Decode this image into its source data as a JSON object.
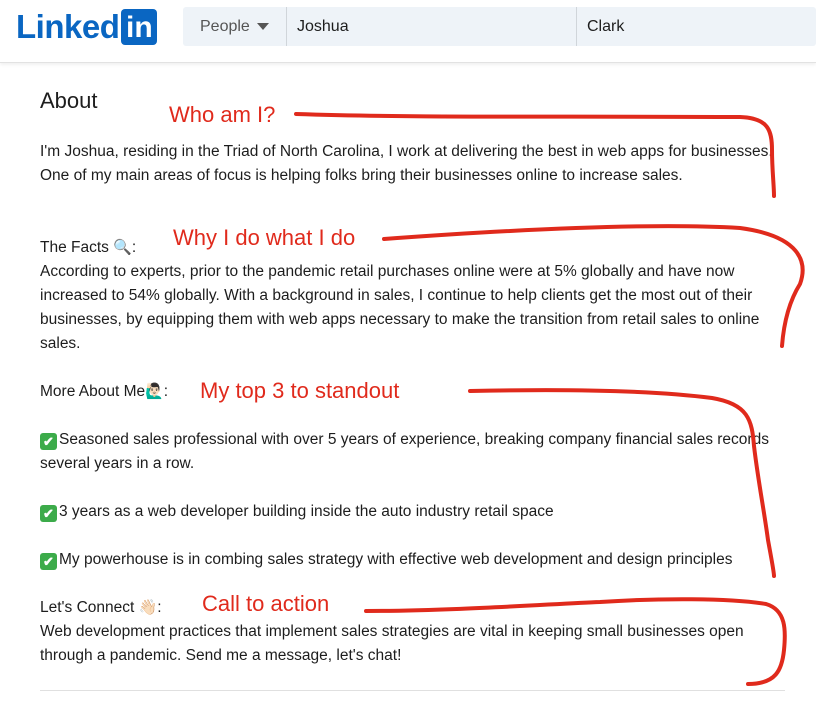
{
  "header": {
    "logo_text": "Linked",
    "logo_box_text": "in",
    "search_type": "People",
    "first_name": "Joshua",
    "last_name": "Clark"
  },
  "about": {
    "title": "About",
    "intro": "I'm Joshua, residing in the Triad of North Carolina, I work at delivering the best in web apps for businesses. One of my main areas of focus is helping folks bring their businesses online to increase sales.",
    "facts_heading": "The Facts",
    "facts_emoji": "🔍",
    "facts_text": "According to experts, prior to the pandemic retail purchases online were at 5% globally and have now increased to 54% globally. With a background in sales, I continue to help clients get the most out of their businesses, by equipping them with web apps necessary to make the transition from retail sales to online sales.",
    "more_heading": "More About Me",
    "more_emoji": "🙋🏻‍♂️",
    "bullets": [
      "Seasoned sales professional with over 5 years of experience, breaking company financial sales records several years in a row.",
      "3 years as a web developer building inside the auto industry retail space",
      "My powerhouse is in combing sales strategy with effective web development and design principles"
    ],
    "bullet_icon": "✔",
    "connect_heading": "Let's Connect",
    "connect_emoji": "👋🏻",
    "connect_text": "Web development practices that implement sales strategies are vital in keeping small businesses open through a pandemic. Send me a message, let's chat!"
  },
  "annotations": {
    "who": "Who am I?",
    "why": "Why I do what I do",
    "top3": "My top 3 to standout",
    "cta": "Call to action",
    "color": "#e02a1c"
  },
  "colors": {
    "brand": "#0a66c2",
    "search_bg": "#eef3f8",
    "check_green": "#3cab4a"
  }
}
